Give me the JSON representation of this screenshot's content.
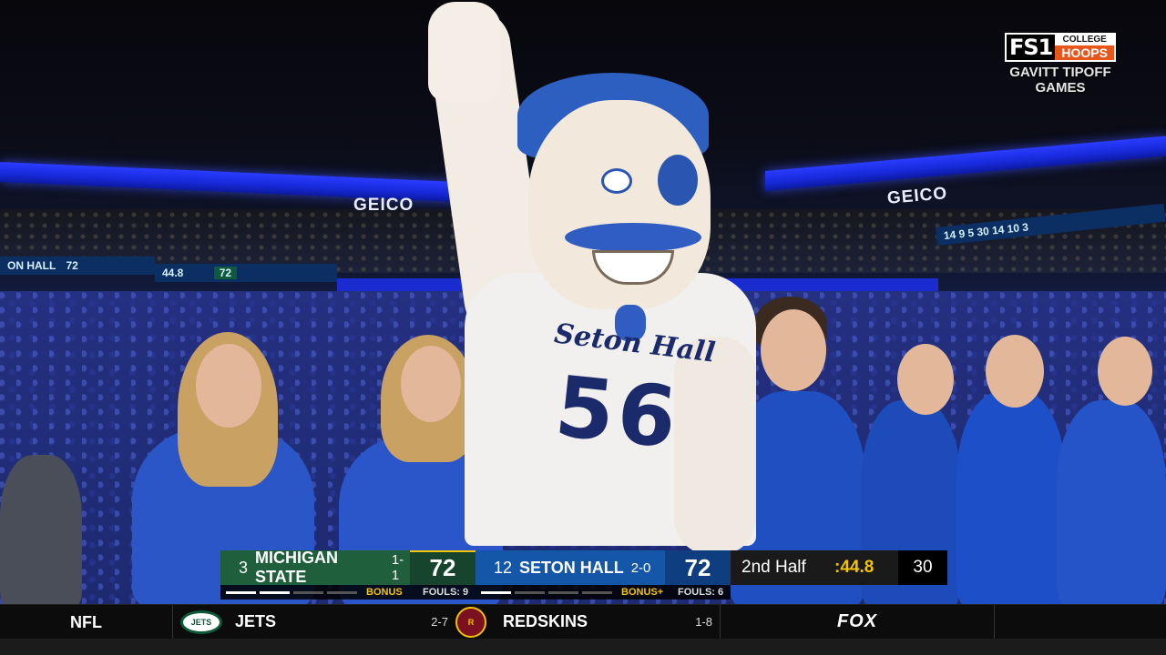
{
  "network": {
    "fs1": "FS1",
    "college": "COLLEGE",
    "hoops": "HOOPS",
    "event_line1": "GAVITT TIPOFF",
    "event_line2": "GAMES"
  },
  "arena": {
    "sponsor_left": "GEICO",
    "sponsor_right": "GEICO",
    "led_left_team": "ON HALL",
    "led_left_score": "72",
    "led_mid_clock": "44.8",
    "led_mid_score": "72",
    "led_right_nums": "14 9 5    30 14 10 3"
  },
  "mascot": {
    "jersey_name": "Seton Hall",
    "jersey_number": "56"
  },
  "scorebug": {
    "away": {
      "rank": "3",
      "name": "MICHIGAN STATE",
      "record": "1-1",
      "score": "72",
      "bonus": "BONUS",
      "fouls": "FOULS: 9",
      "timeouts_remaining": 2,
      "color": "#1f5f3c"
    },
    "home": {
      "rank": "12",
      "name": "SETON HALL",
      "record": "2-0",
      "score": "72",
      "bonus": "BONUS+",
      "fouls": "FOULS: 6",
      "timeouts_remaining": 1,
      "color": "#1456a8"
    },
    "period": "2nd Half",
    "clock": ":44.8",
    "shot_clock": "30"
  },
  "ticker": {
    "league": "NFL",
    "team1": {
      "name": "JETS",
      "record": "2-7",
      "logo_icon": "jets-logo-icon"
    },
    "team2": {
      "name": "REDSKINS",
      "record": "1-8",
      "logo_icon": "redskins-logo-icon"
    },
    "network": "FOX"
  }
}
